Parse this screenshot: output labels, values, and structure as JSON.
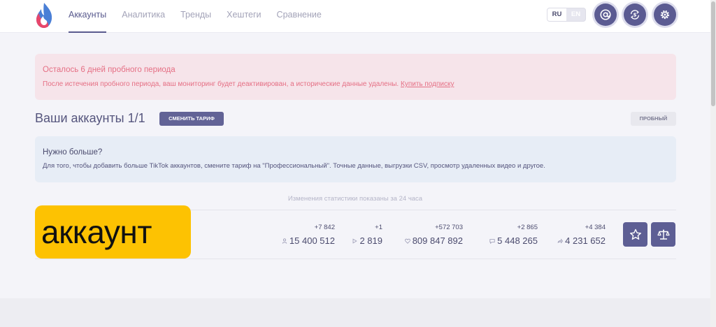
{
  "header": {
    "logo_icon": "flame-logo-icon",
    "nav": [
      {
        "label": "Аккаунты",
        "active": true
      },
      {
        "label": "Аналитика",
        "active": false
      },
      {
        "label": "Тренды",
        "active": false
      },
      {
        "label": "Хештеги",
        "active": false
      },
      {
        "label": "Сравнение",
        "active": false
      }
    ],
    "lang": {
      "ru": "RU",
      "en": "EN",
      "selected": "RU"
    },
    "icons": [
      "at-icon",
      "dollar-cycle-icon",
      "gear-icon"
    ]
  },
  "trial_alert": {
    "title": "Осталось 6 дней пробного периода",
    "text": "После истечения пробного периода, ваш мониторинг будет деактивирован, а исторические данные удалены.",
    "link": "Купить подписку"
  },
  "accounts": {
    "title": "Ваши аккаунты 1/1",
    "change_plan_label": "СМЕНИТЬ ТАРИФ",
    "plan_badge": "ПРОБНЫЙ"
  },
  "info_box": {
    "title": "Нужно больше?",
    "text": "Для того, чтобы добавить больше TikTok аккаунтов, смените тариф на \"Профессиональный\". Точные данные, выгрузки CSV, просмотр удаленных видео и другое."
  },
  "stats_note": "Изменения статистики показаны за 24 часа",
  "account_row": {
    "name": "аккаунт",
    "stats": [
      {
        "delta": "+7 842",
        "value": "15 400 512",
        "icon": "followers-icon"
      },
      {
        "delta": "+1",
        "value": "2 819",
        "icon": "play-icon"
      },
      {
        "delta": "+572 703",
        "value": "809 847 892",
        "icon": "heart-icon"
      },
      {
        "delta": "+2 865",
        "value": "5 448 265",
        "icon": "comment-icon"
      },
      {
        "delta": "+4 384",
        "value": "4 231 652",
        "icon": "share-icon"
      }
    ],
    "actions": [
      "star-icon",
      "scales-icon"
    ]
  },
  "colors": {
    "accent": "#5d5e94",
    "alert_bg": "#f6e4ea",
    "alert_text": "#e56f84",
    "info_bg": "#e7edf6",
    "badge_yellow": "#fdc202"
  }
}
